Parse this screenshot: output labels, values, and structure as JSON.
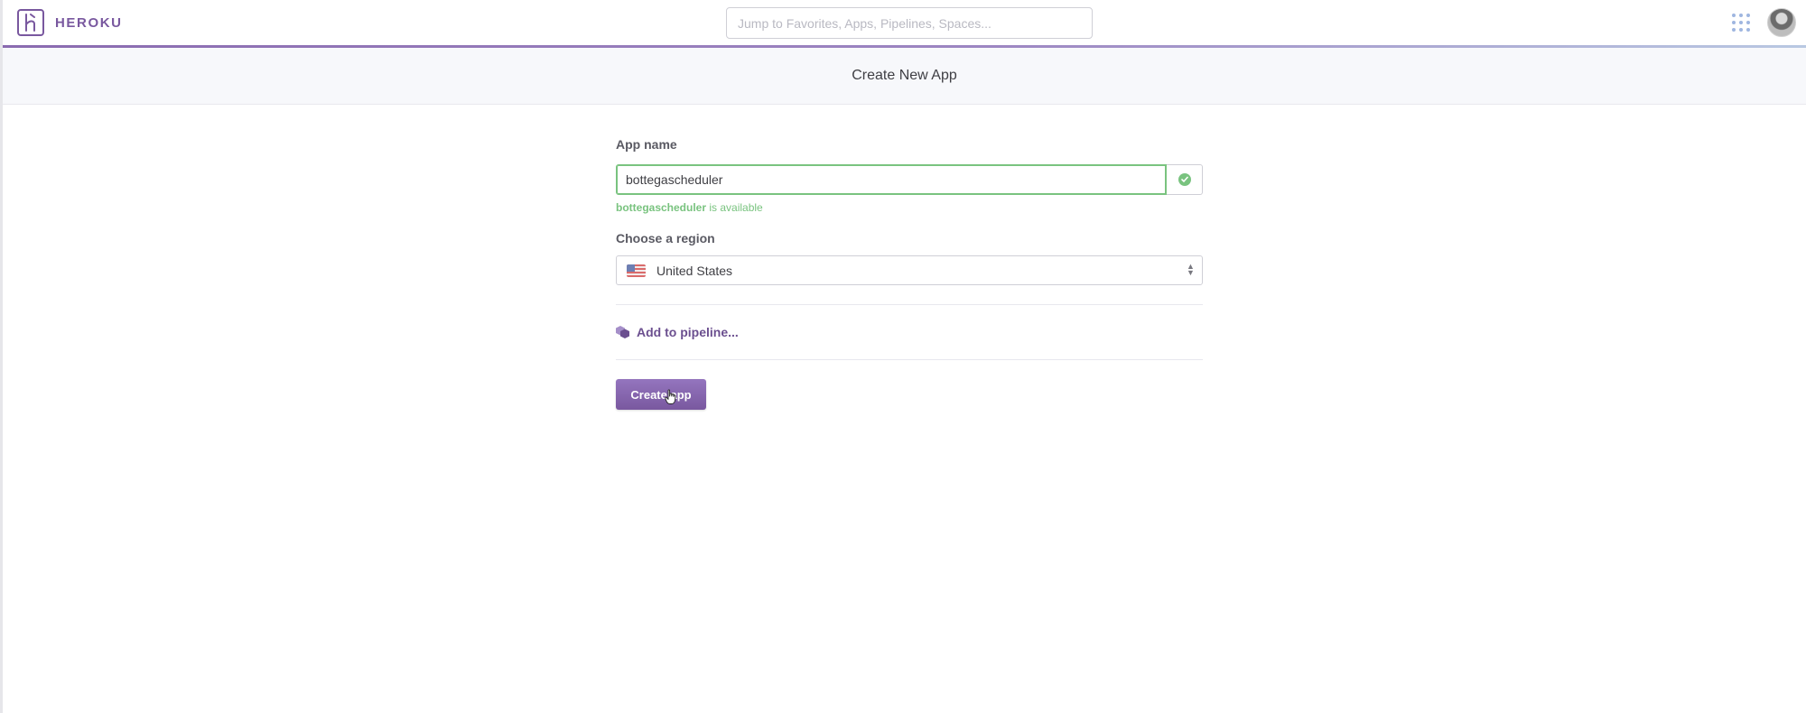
{
  "navbar": {
    "brand": "HEROKU",
    "search": {
      "placeholder": "Jump to Favorites, Apps, Pipelines, Spaces..."
    }
  },
  "subheader": {
    "title": "Create New App"
  },
  "form": {
    "app_name_label": "App name",
    "app_name_value": "bottegascheduler",
    "availability": {
      "name": "bottegascheduler",
      "suffix": " is available"
    },
    "region_label": "Choose a region",
    "region_selected": "United States",
    "pipeline_link": "Add to pipeline...",
    "create_button": "Create app"
  },
  "colors": {
    "brand": "#79589f",
    "success": "#79c37f",
    "subheader_bg": "#f7f8fb"
  },
  "icons": {
    "logo": "heroku-logo-icon",
    "apps": "apps-grid-icon",
    "check": "check-circle-icon",
    "flag": "us-flag-icon",
    "pipeline": "pipeline-icon",
    "chevron": "updown-chevron-icon"
  }
}
